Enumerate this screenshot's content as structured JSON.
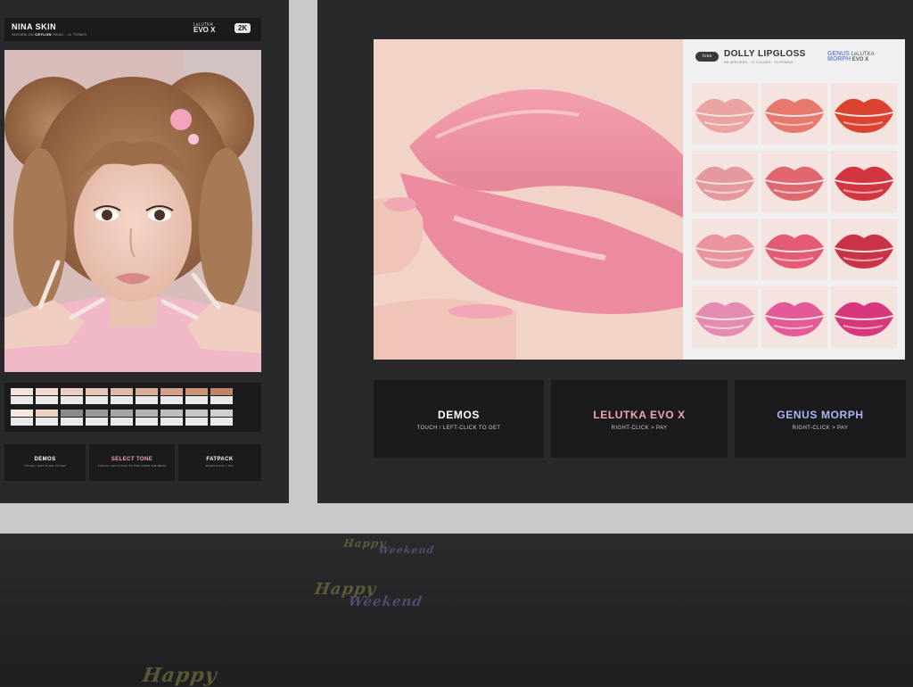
{
  "nina": {
    "title": "NINA SKIN",
    "subtitle_pre": "SHOWN ON ",
    "subtitle_head": "CEYLON",
    "subtitle_post": " HEAD · 11 TONES",
    "logo_small": "LeLUTKA",
    "logo_big": "EVO X",
    "resolution_badge": "2K",
    "buttons": [
      {
        "title": "DEMOS",
        "sub": "TOUCH / LEFT-CLICK TO GET",
        "color": "#ffffff"
      },
      {
        "title": "SELECT TONE",
        "sub": "TOUCH / LEFT-CLICK TO PICK FROM THE MENU",
        "color": "#f5a7ad"
      },
      {
        "title": "FATPACK",
        "sub": "RIGHT-CLICK > PAY",
        "color": "#ffffff"
      }
    ],
    "tones": [
      "#f3e3dc",
      "#f0d9cf",
      "#ebcfc3",
      "#e7c4b4",
      "#e1b9a6",
      "#dcae98",
      "#d4a188",
      "#cb9477",
      "#bf8465",
      "#f6e8e0",
      "#edd2c2",
      "#8b8b8b",
      "#999999",
      "#a6a6a6",
      "#b2b2b2",
      "#bdbdbd",
      "#c7c7c7",
      "#d0d0d0"
    ]
  },
  "dolly": {
    "brand_badge": "Ivex",
    "title": "DOLLY LIPGLOSS",
    "subtitle": "HD APPLIERS · 12 COLORS · FLIPPABLE",
    "genus_small": "GENUS",
    "genus_big": "MORPH",
    "lelutka_small": "LeLUTKA",
    "lelutka_big": "EVO X",
    "shades": [
      "#e9a3a0",
      "#e6786d",
      "#d9432f",
      "#e49a9c",
      "#e06670",
      "#d2353f",
      "#e9949f",
      "#e45a72",
      "#c93345",
      "#e38bb0",
      "#e45a98",
      "#d8377c"
    ]
  },
  "right_buttons": [
    {
      "title": "DEMOS",
      "sub": "TOUCH / LEFT-CLICK TO GET",
      "color": "#ffffff"
    },
    {
      "title": "LELUTKA EVO X",
      "sub": "RIGHT-CLICK > PAY",
      "color": "#f3a5b2"
    },
    {
      "title": "GENUS MORPH",
      "sub": "RIGHT-CLICK > PAY",
      "color": "#a8b6f2"
    }
  ],
  "floor_logo": {
    "main": "Happy",
    "sub": "Weekend"
  }
}
